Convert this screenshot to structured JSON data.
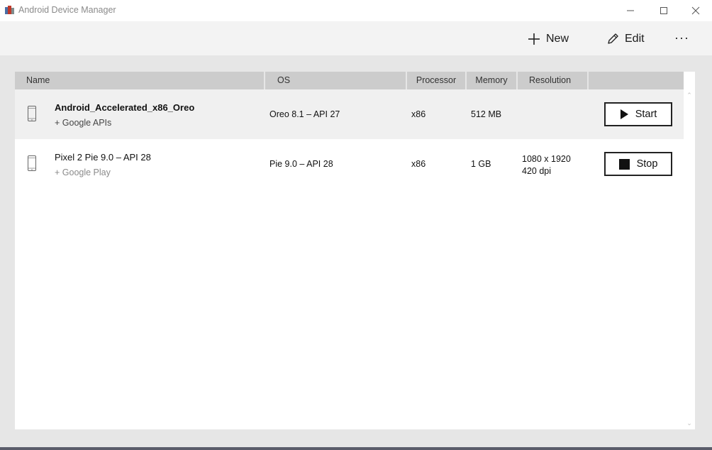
{
  "window": {
    "title": "Android Device Manager",
    "icons": {
      "app": "app-icon",
      "minimize": "minimize-icon",
      "maximize": "maximize-icon",
      "close": "close-icon"
    }
  },
  "toolbar": {
    "new_label": "New",
    "edit_label": "Edit",
    "more_label": "···",
    "icons": {
      "new": "plus-icon",
      "edit": "pencil-icon"
    }
  },
  "table": {
    "columns": [
      "Name",
      "OS",
      "Processor",
      "Memory",
      "Resolution",
      ""
    ],
    "rows": [
      {
        "name": "Android_Accelerated_x86_Oreo",
        "sub": "+ Google APIs",
        "os": "Oreo 8.1 – API 27",
        "processor": "x86",
        "memory": "512 MB",
        "resolution_line1": "",
        "resolution_line2": "",
        "action": "Start",
        "action_icon": "play-icon",
        "selected": true
      },
      {
        "name": "Pixel 2 Pie 9.0 – API 28",
        "sub": "+ Google Play",
        "os": "Pie 9.0 – API 28",
        "processor": "x86",
        "memory": "1 GB",
        "resolution_line1": "1080 x 1920",
        "resolution_line2": "420 dpi",
        "action": "Stop",
        "action_icon": "stop-icon",
        "selected": false
      }
    ]
  },
  "colors": {
    "background": "#e6e6e6",
    "toolbar": "#f3f3f3",
    "header": "#cccccc",
    "selected_row": "#f0f0f0"
  }
}
